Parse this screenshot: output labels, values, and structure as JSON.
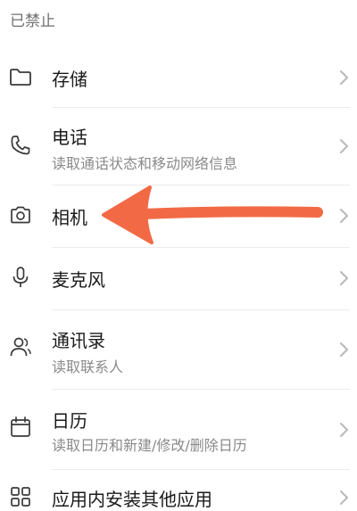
{
  "section": {
    "title": "已禁止"
  },
  "items": [
    {
      "label": "存储",
      "subtitle": ""
    },
    {
      "label": "电话",
      "subtitle": "读取通话状态和移动网络信息"
    },
    {
      "label": "相机",
      "subtitle": ""
    },
    {
      "label": "麦克风",
      "subtitle": ""
    },
    {
      "label": "通讯录",
      "subtitle": "读取联系人"
    },
    {
      "label": "日历",
      "subtitle": "读取日历和新建/修改/删除日历"
    },
    {
      "label": "应用内安装其他应用",
      "subtitle": ""
    }
  ],
  "colors": {
    "annotation_arrow": "#f26a45",
    "chevron": "#b8b8b8",
    "icon": "#3a3a3a"
  }
}
